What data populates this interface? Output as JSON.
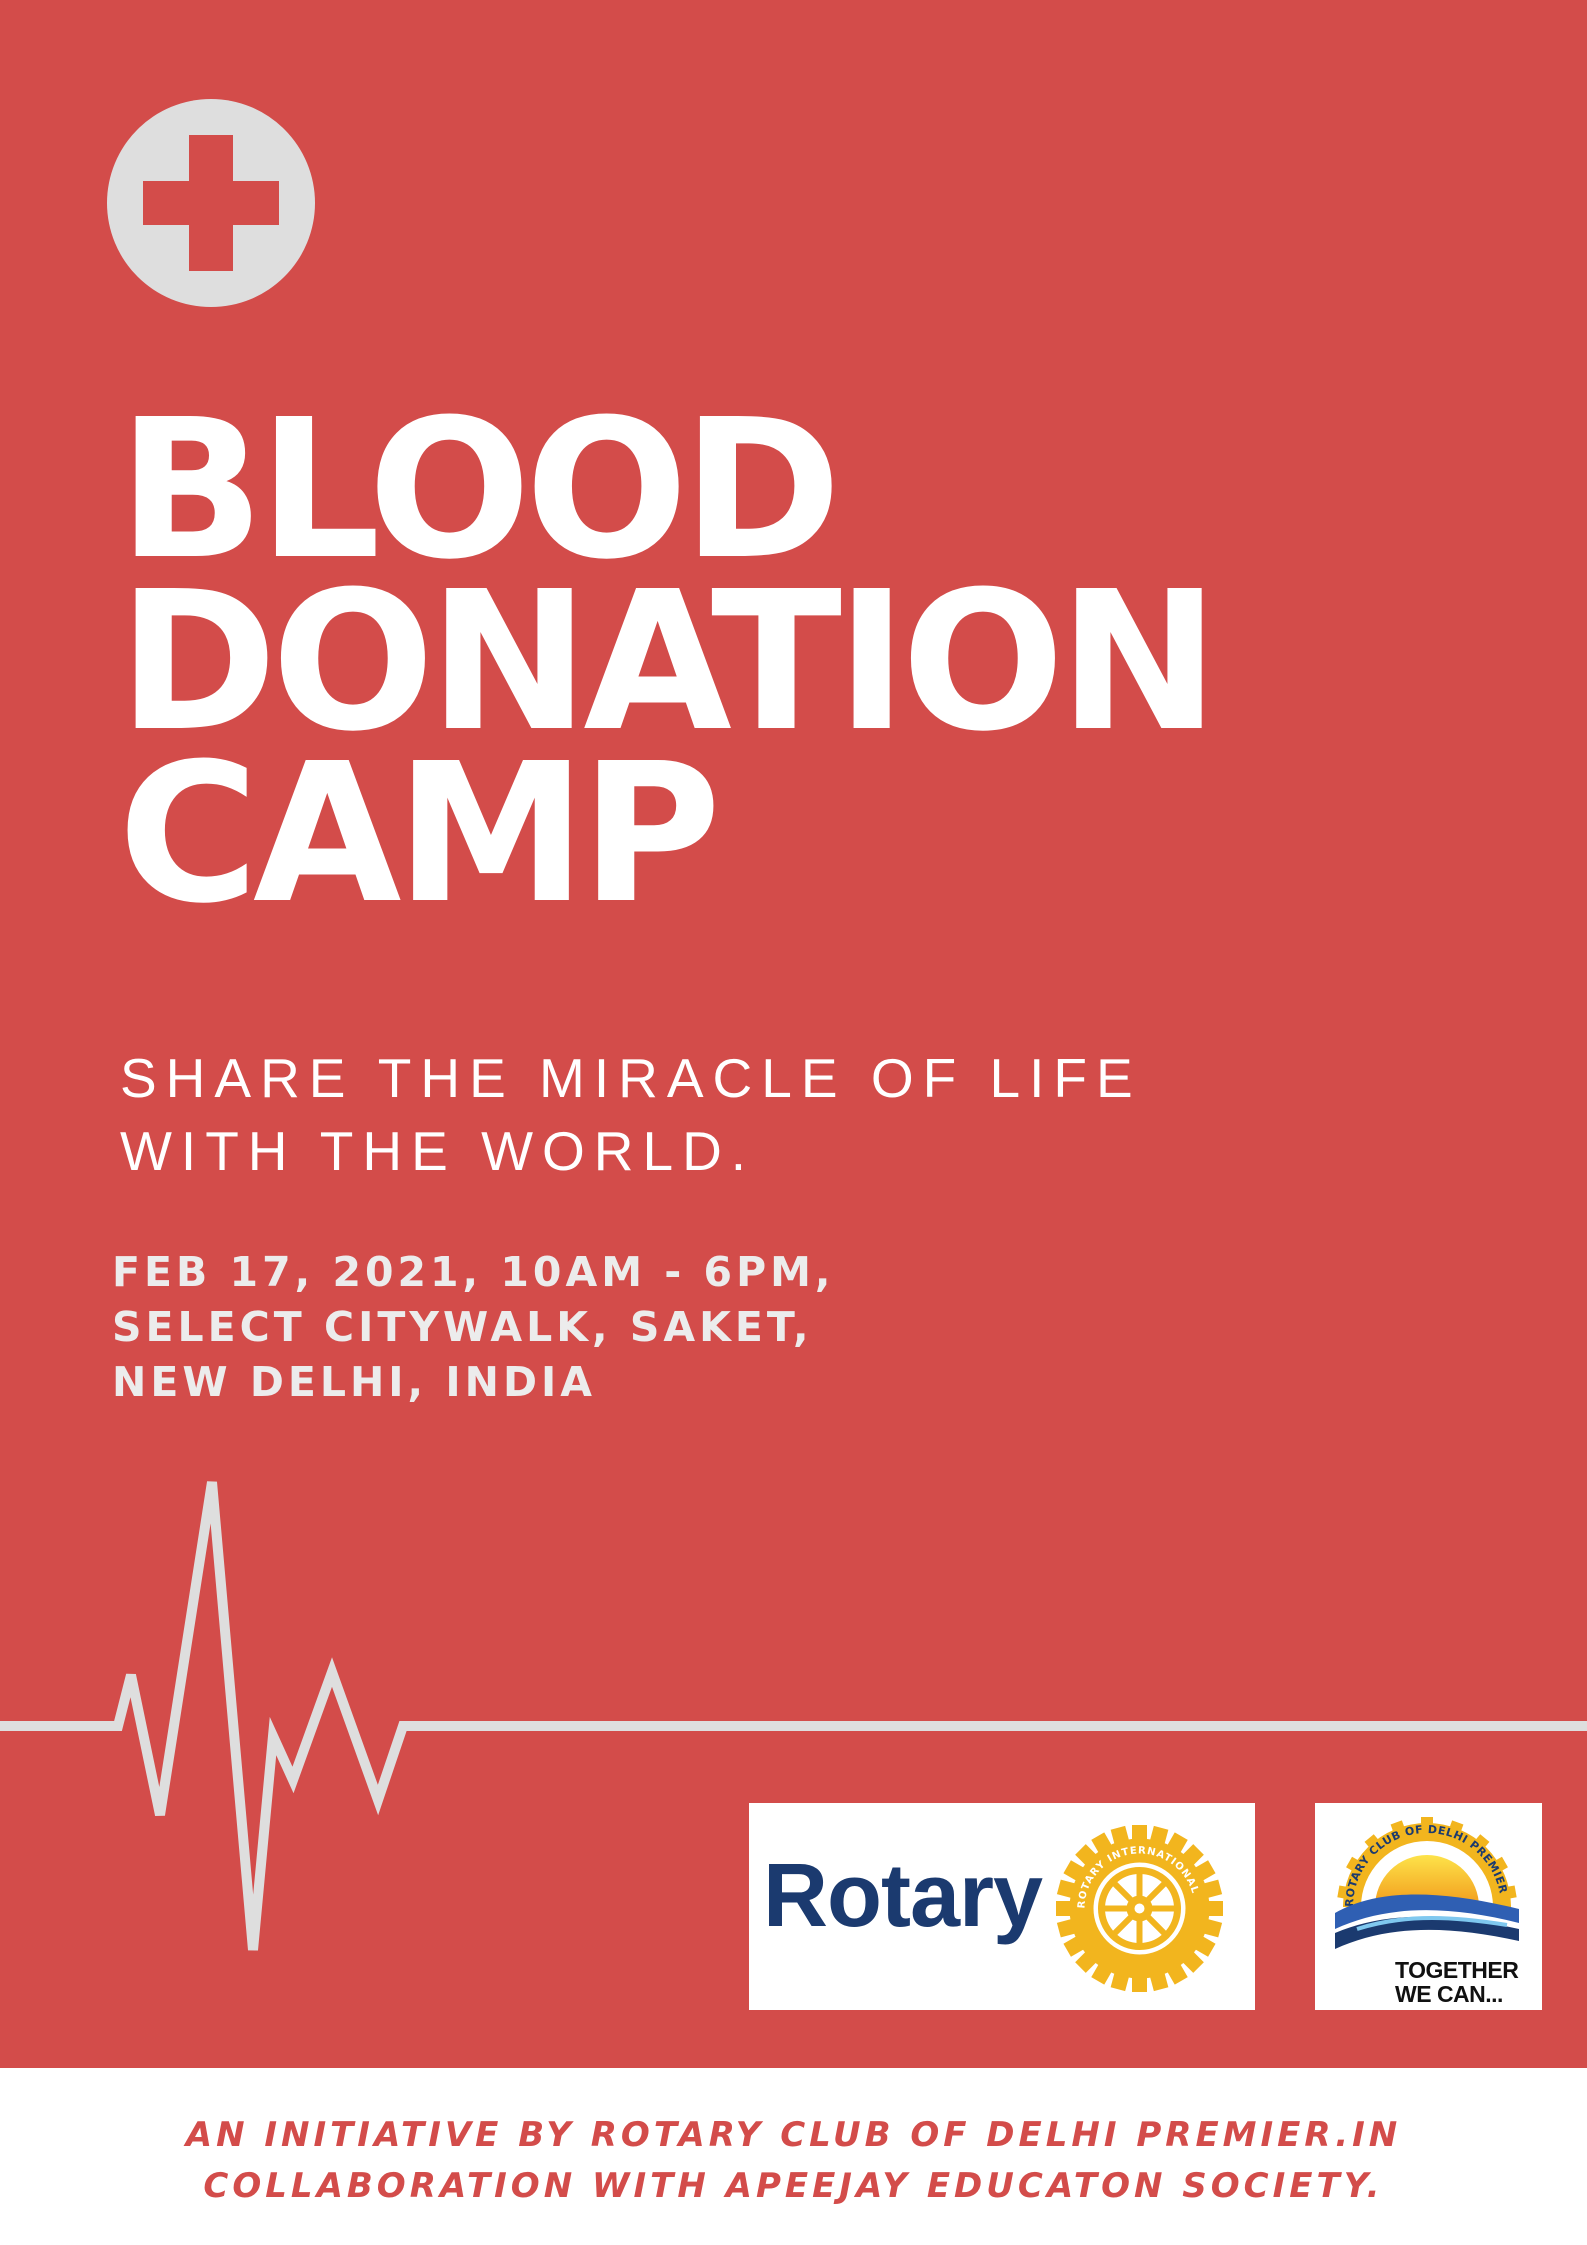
{
  "title_lines": [
    "BLOOD",
    "DONATION",
    "CAMP"
  ],
  "tagline_lines": [
    "SHARE THE MIRACLE OF LIFE",
    "WITH THE WORLD."
  ],
  "detail_lines": [
    "FEB 17, 2021, 10AM - 6PM,",
    "SELECT CITYWALK, SAKET,",
    "NEW DELHI, INDIA"
  ],
  "logos": {
    "rotary": {
      "word": "Rotary",
      "ring_text": "ROTARY INTERNATIONAL"
    },
    "club": {
      "ring_text": "ROTARY CLUB OF DELHI PREMIER",
      "tagline_lines": [
        "TOGETHER",
        "WE CAN..."
      ]
    }
  },
  "footer_lines": [
    "AN INITIATIVE BY ROTARY CLUB OF DELHI PREMIER.IN",
    "COLLABORATION WITH APEEJAY EDUCATON SOCIETY."
  ],
  "colors": {
    "background": "#d34c4a",
    "light_gray": "#dedede",
    "white": "#ffffff",
    "rotary_navy": "#1b3a6f",
    "rotary_gold": "#f2b51e"
  },
  "icons": [
    "cross-icon",
    "heartbeat-line-icon",
    "rotary-wheel-icon",
    "sun-waves-icon"
  ]
}
